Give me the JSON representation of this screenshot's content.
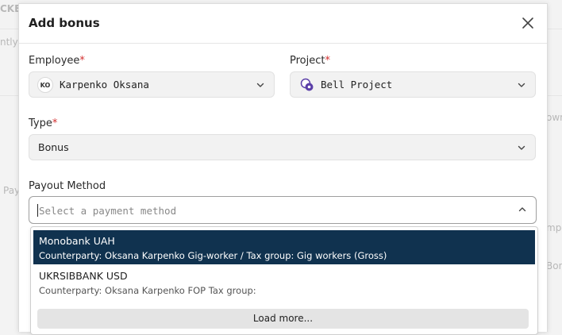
{
  "background": {
    "fragments": [
      "CKE",
      "ntly",
      "ownl",
      "Pay",
      "mpen",
      "Bonu"
    ]
  },
  "modal": {
    "title": "Add bonus",
    "employee": {
      "label": "Employee",
      "required_mark": "*",
      "avatar_initials": "KO",
      "value": "Karpenko Oksana"
    },
    "project": {
      "label": "Project",
      "required_mark": "*",
      "value": "Bell Project",
      "icon": "project-logo-icon"
    },
    "type": {
      "label": "Type",
      "required_mark": "*",
      "value": "Bonus"
    },
    "payout": {
      "label": "Payout Method",
      "placeholder": "Select a payment method",
      "value": ""
    },
    "options": [
      {
        "title": "Monobank UAH",
        "detail": "Counterparty: Oksana Karpenko Gig-worker / Tax group: Gig workers (Gross)",
        "selected": true
      },
      {
        "title": "UKRSIBBANK USD",
        "detail": "Counterparty: Oksana Karpenko FOP Tax group:",
        "selected": false
      }
    ],
    "load_more": "Load more..."
  },
  "colors": {
    "selected_option_bg": "#10324f",
    "required": "#d32f2f",
    "project_icon": "#5b3fa8"
  }
}
